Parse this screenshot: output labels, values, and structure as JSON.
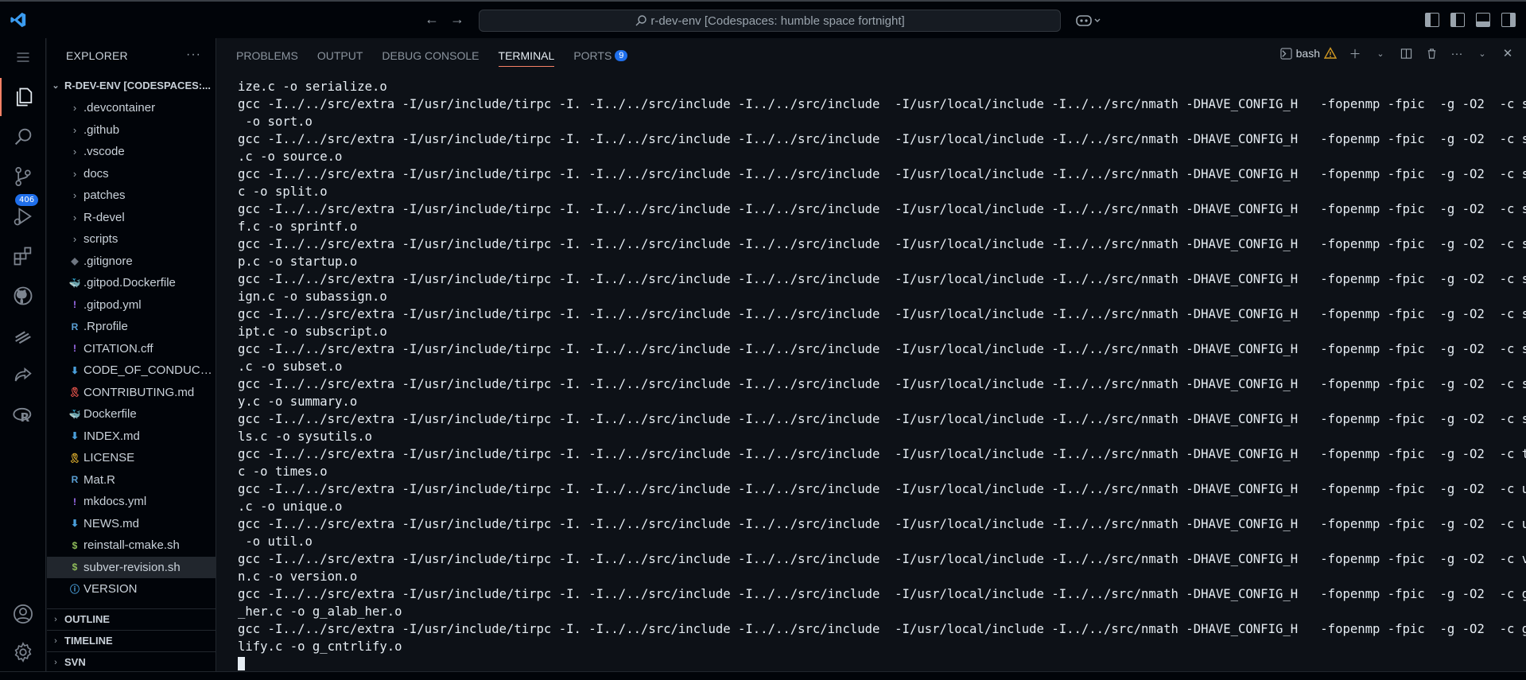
{
  "window": {
    "command_center": "r-dev-env [Codespaces: humble space fortnight]"
  },
  "activity_bar": {
    "items": [
      "explorer-icon",
      "search-icon",
      "source-control-icon",
      "run-debug-icon",
      "extensions-icon",
      "github-icon",
      "remote-explorer-icon",
      "live-share-icon",
      "r-icon",
      "account-icon",
      "settings-icon"
    ],
    "source_control_badge": "406"
  },
  "sidebar": {
    "title": "EXPLORER",
    "root": "R-DEV-ENV [CODESPACES:...",
    "items": [
      {
        "label": ".devcontainer",
        "type": "folder"
      },
      {
        "label": ".github",
        "type": "folder"
      },
      {
        "label": ".vscode",
        "type": "folder"
      },
      {
        "label": "docs",
        "type": "folder"
      },
      {
        "label": "patches",
        "type": "folder"
      },
      {
        "label": "R-devel",
        "type": "folder"
      },
      {
        "label": "scripts",
        "type": "folder"
      },
      {
        "label": ".gitignore",
        "type": "file",
        "icon": "◆",
        "color": "#6e7681"
      },
      {
        "label": ".gitpod.Dockerfile",
        "type": "file",
        "icon": "🐳",
        "color": "#4a9eda"
      },
      {
        "label": ".gitpod.yml",
        "type": "file",
        "icon": "!",
        "color": "#a371f7"
      },
      {
        "label": ".Rprofile",
        "type": "file",
        "icon": "R",
        "color": "#5a9fd4"
      },
      {
        "label": "CITATION.cff",
        "type": "file",
        "icon": "!",
        "color": "#a371f7"
      },
      {
        "label": "CODE_OF_CONDUCT....",
        "type": "file",
        "icon": "⬇",
        "color": "#4a9eda"
      },
      {
        "label": "CONTRIBUTING.md",
        "type": "file",
        "icon": "🎗",
        "color": "#e5534b"
      },
      {
        "label": "Dockerfile",
        "type": "file",
        "icon": "🐳",
        "color": "#4a9eda"
      },
      {
        "label": "INDEX.md",
        "type": "file",
        "icon": "⬇",
        "color": "#4a9eda"
      },
      {
        "label": "LICENSE",
        "type": "file",
        "icon": "🎗",
        "color": "#d4a72c"
      },
      {
        "label": "Mat.R",
        "type": "file",
        "icon": "R",
        "color": "#5a9fd4"
      },
      {
        "label": "mkdocs.yml",
        "type": "file",
        "icon": "!",
        "color": "#a371f7"
      },
      {
        "label": "NEWS.md",
        "type": "file",
        "icon": "⬇",
        "color": "#4a9eda"
      },
      {
        "label": "reinstall-cmake.sh",
        "type": "file",
        "icon": "$",
        "color": "#8fbc5a"
      },
      {
        "label": "subver-revision.sh",
        "type": "file",
        "icon": "$",
        "color": "#8fbc5a",
        "selected": true
      },
      {
        "label": "VERSION",
        "type": "file",
        "icon": "ⓘ",
        "color": "#4a9eda"
      }
    ],
    "sections": [
      "OUTLINE",
      "TIMELINE",
      "SVN"
    ]
  },
  "panel": {
    "tabs": [
      {
        "label": "PROBLEMS",
        "active": false
      },
      {
        "label": "OUTPUT",
        "active": false
      },
      {
        "label": "DEBUG CONSOLE",
        "active": false
      },
      {
        "label": "TERMINAL",
        "active": true
      },
      {
        "label": "PORTS",
        "active": false,
        "badge": "9"
      }
    ],
    "shell": "bash"
  },
  "terminal": {
    "lines": [
      "ize.c -o serialize.o",
      "gcc -I../../src/extra -I/usr/include/tirpc -I. -I../../src/include -I../../src/include  -I/usr/local/include -I../../src/nmath -DHAVE_CONFIG_H   -fopenmp -fpic  -g -O2  -c sort.c",
      " -o sort.o",
      "gcc -I../../src/extra -I/usr/include/tirpc -I. -I../../src/include -I../../src/include  -I/usr/local/include -I../../src/nmath -DHAVE_CONFIG_H   -fopenmp -fpic  -g -O2  -c source",
      ".c -o source.o",
      "gcc -I../../src/extra -I/usr/include/tirpc -I. -I../../src/include -I../../src/include  -I/usr/local/include -I../../src/nmath -DHAVE_CONFIG_H   -fopenmp -fpic  -g -O2  -c split.",
      "c -o split.o",
      "gcc -I../../src/extra -I/usr/include/tirpc -I. -I../../src/include -I../../src/include  -I/usr/local/include -I../../src/nmath -DHAVE_CONFIG_H   -fopenmp -fpic  -g -O2  -c sprint",
      "f.c -o sprintf.o",
      "gcc -I../../src/extra -I/usr/include/tirpc -I. -I../../src/include -I../../src/include  -I/usr/local/include -I../../src/nmath -DHAVE_CONFIG_H   -fopenmp -fpic  -g -O2  -c startu",
      "p.c -o startup.o",
      "gcc -I../../src/extra -I/usr/include/tirpc -I. -I../../src/include -I../../src/include  -I/usr/local/include -I../../src/nmath -DHAVE_CONFIG_H   -fopenmp -fpic  -g -O2  -c subass",
      "ign.c -o subassign.o",
      "gcc -I../../src/extra -I/usr/include/tirpc -I. -I../../src/include -I../../src/include  -I/usr/local/include -I../../src/nmath -DHAVE_CONFIG_H   -fopenmp -fpic  -g -O2  -c subscr",
      "ipt.c -o subscript.o",
      "gcc -I../../src/extra -I/usr/include/tirpc -I. -I../../src/include -I../../src/include  -I/usr/local/include -I../../src/nmath -DHAVE_CONFIG_H   -fopenmp -fpic  -g -O2  -c subset",
      ".c -o subset.o",
      "gcc -I../../src/extra -I/usr/include/tirpc -I. -I../../src/include -I../../src/include  -I/usr/local/include -I../../src/nmath -DHAVE_CONFIG_H   -fopenmp -fpic  -g -O2  -c summar",
      "y.c -o summary.o",
      "gcc -I../../src/extra -I/usr/include/tirpc -I. -I../../src/include -I../../src/include  -I/usr/local/include -I../../src/nmath -DHAVE_CONFIG_H   -fopenmp -fpic  -g -O2  -c sysuti",
      "ls.c -o sysutils.o",
      "gcc -I../../src/extra -I/usr/include/tirpc -I. -I../../src/include -I../../src/include  -I/usr/local/include -I../../src/nmath -DHAVE_CONFIG_H   -fopenmp -fpic  -g -O2  -c times.",
      "c -o times.o",
      "gcc -I../../src/extra -I/usr/include/tirpc -I. -I../../src/include -I../../src/include  -I/usr/local/include -I../../src/nmath -DHAVE_CONFIG_H   -fopenmp -fpic  -g -O2  -c unique",
      ".c -o unique.o",
      "gcc -I../../src/extra -I/usr/include/tirpc -I. -I../../src/include -I../../src/include  -I/usr/local/include -I../../src/nmath -DHAVE_CONFIG_H   -fopenmp -fpic  -g -O2  -c util.c",
      " -o util.o",
      "gcc -I../../src/extra -I/usr/include/tirpc -I. -I../../src/include -I../../src/include  -I/usr/local/include -I../../src/nmath -DHAVE_CONFIG_H   -fopenmp -fpic  -g -O2  -c versio",
      "n.c -o version.o",
      "gcc -I../../src/extra -I/usr/include/tirpc -I. -I../../src/include -I../../src/include  -I/usr/local/include -I../../src/nmath -DHAVE_CONFIG_H   -fopenmp -fpic  -g -O2  -c g_alab",
      "_her.c -o g_alab_her.o",
      "gcc -I../../src/extra -I/usr/include/tirpc -I. -I../../src/include -I../../src/include  -I/usr/local/include -I../../src/nmath -DHAVE_CONFIG_H   -fopenmp -fpic  -g -O2  -c g_cntr",
      "lify.c -o g_cntrlify.o"
    ]
  }
}
